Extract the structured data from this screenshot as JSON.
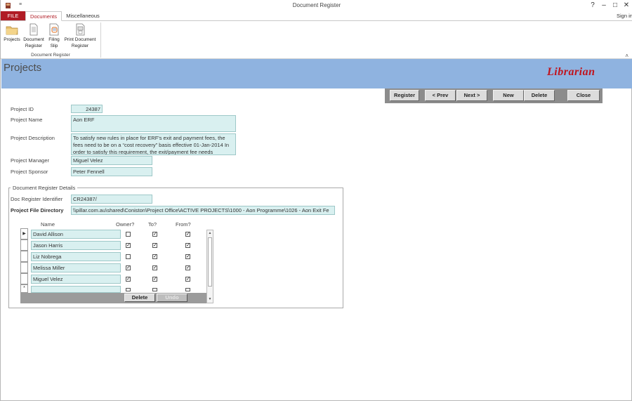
{
  "window": {
    "title": "Document Register",
    "quick_access": "≡",
    "controls": {
      "help": "?",
      "minimize": "–",
      "maximize": "□",
      "close": "✕"
    },
    "sign_in": "Sign in"
  },
  "ribbon": {
    "tabs": {
      "file": "FILE",
      "documents": "Documents",
      "misc": "Miscellaneous"
    },
    "buttons": {
      "projects": "Projects",
      "document_register_1": "Document",
      "document_register_2": "Register",
      "filing_slip_1": "Filing",
      "filing_slip_2": "Slip",
      "print_register_1": "Print Document",
      "print_register_2": "Register"
    },
    "group_label": "Document Register",
    "collapse": "˄"
  },
  "header": {
    "title": "Projects",
    "logo": "Librarian"
  },
  "nav": {
    "register": "Register",
    "prev": "< Prev",
    "next": "Next >",
    "new": "New",
    "delete": "Delete",
    "close": "Close"
  },
  "form": {
    "project_id": {
      "label": "Project ID",
      "value": "24387"
    },
    "project_name": {
      "label": "Project Name",
      "value": "Aon ERF"
    },
    "project_description": {
      "label": "Project Description",
      "value": "To satisfy new rules in place for ERF's exit and payment fees, the fees need to be on a “cost recovery” basis effective 01-Jan-2014 In order to satisfy this requirement, the exit/payment fee needs"
    },
    "project_manager": {
      "label": "Project Manager",
      "value": "Miguel Velez"
    },
    "project_sponsor": {
      "label": "Project Sponsor",
      "value": "Peter Fennell"
    }
  },
  "details": {
    "group_label": "Document Register Details",
    "doc_register_identifier": {
      "label": "Doc Register Identifier",
      "value": "CR24387/"
    },
    "project_file_directory": {
      "label": "Project File Directory",
      "value": "\\\\pillar.com.au\\shared\\Coniston\\Project Office\\ACTIVE PROJECTS\\1000 - Aon Programme\\1026 - Aon Exit Fe"
    }
  },
  "people": {
    "columns": {
      "name": "Name",
      "owner": "Owner?",
      "to": "To?",
      "from": "From?"
    },
    "rows": [
      {
        "name": "David Allison",
        "owner": false,
        "to": true,
        "from": true,
        "current": true
      },
      {
        "name": "Jason Harris",
        "owner": true,
        "to": true,
        "from": true
      },
      {
        "name": "Liz Nobrega",
        "owner": false,
        "to": true,
        "from": true
      },
      {
        "name": "Melissa Miller",
        "owner": true,
        "to": true,
        "from": true
      },
      {
        "name": "Miguel Velez",
        "owner": true,
        "to": true,
        "from": true
      }
    ],
    "new_row_marker": "*",
    "current_marker": "▶",
    "delete_label": "Delete",
    "undo_label": "Undo"
  }
}
